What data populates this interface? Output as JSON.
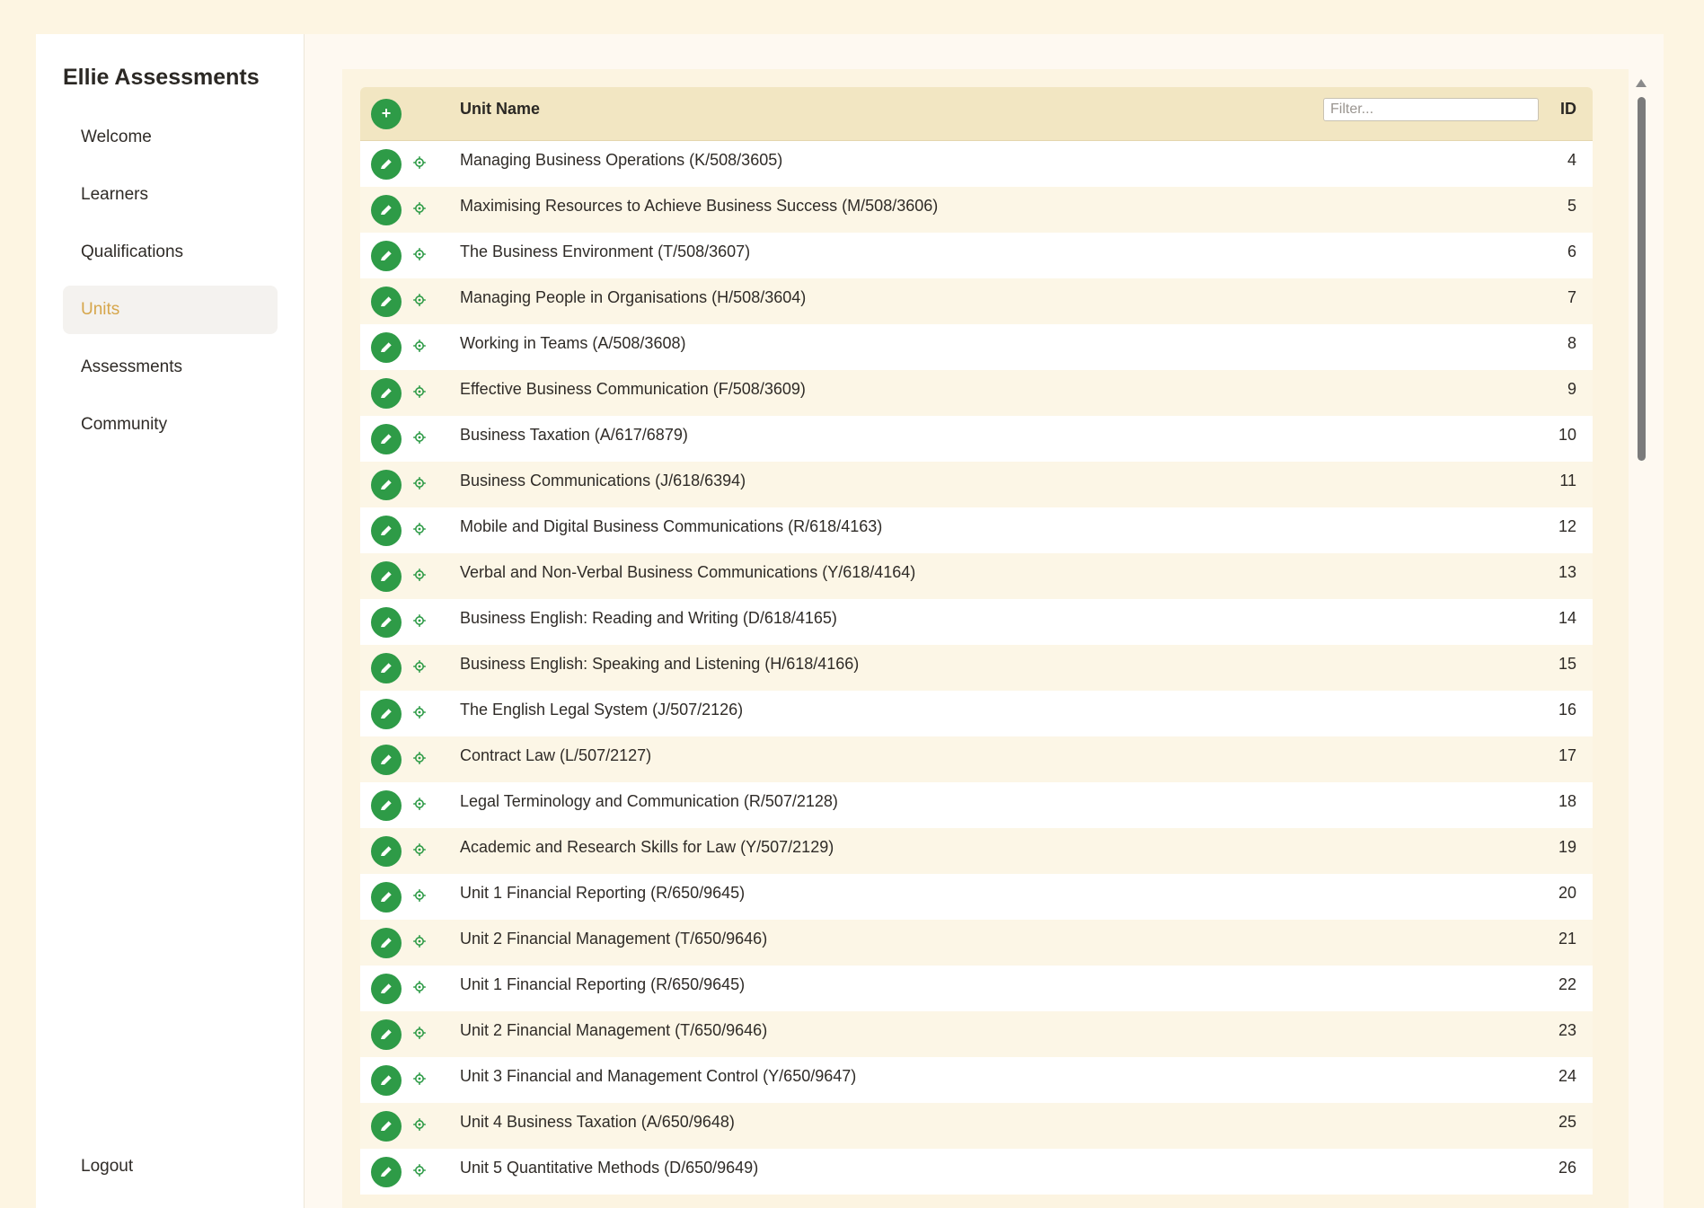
{
  "app": {
    "title": "Ellie Assessments"
  },
  "nav": {
    "items": [
      {
        "label": "Welcome"
      },
      {
        "label": "Learners"
      },
      {
        "label": "Qualifications"
      },
      {
        "label": "Units"
      },
      {
        "label": "Assessments"
      },
      {
        "label": "Community"
      }
    ],
    "active": "Units",
    "logout_label": "Logout"
  },
  "table": {
    "add_label": "+",
    "col_name": "Unit Name",
    "col_id": "ID",
    "filter_placeholder": "Filter...",
    "rows": [
      {
        "name": "Managing Business Operations (K/508/3605)",
        "id": "4"
      },
      {
        "name": "Maximising Resources to Achieve Business Success (M/508/3606)",
        "id": "5"
      },
      {
        "name": "The Business Environment (T/508/3607)",
        "id": "6"
      },
      {
        "name": "Managing People in Organisations (H/508/3604)",
        "id": "7"
      },
      {
        "name": "Working in Teams (A/508/3608)",
        "id": "8"
      },
      {
        "name": "Effective Business Communication (F/508/3609)",
        "id": "9"
      },
      {
        "name": "Business Taxation (A/617/6879)",
        "id": "10"
      },
      {
        "name": "Business Communications (J/618/6394)",
        "id": "11"
      },
      {
        "name": "Mobile and Digital Business Communications (R/618/4163)",
        "id": "12"
      },
      {
        "name": "Verbal and Non-Verbal Business Communications (Y/618/4164)",
        "id": "13"
      },
      {
        "name": "Business English: Reading and Writing (D/618/4165)",
        "id": "14"
      },
      {
        "name": "Business English: Speaking and Listening (H/618/4166)",
        "id": "15"
      },
      {
        "name": "The English Legal System (J/507/2126)",
        "id": "16"
      },
      {
        "name": "Contract Law (L/507/2127)",
        "id": "17"
      },
      {
        "name": "Legal Terminology and Communication (R/507/2128)",
        "id": "18"
      },
      {
        "name": "Academic and Research Skills for Law (Y/507/2129)",
        "id": "19"
      },
      {
        "name": "Unit 1 Financial Reporting (R/650/9645)",
        "id": "20"
      },
      {
        "name": "Unit 2 Financial Management (T/650/9646)",
        "id": "21"
      },
      {
        "name": "Unit 1 Financial Reporting (R/650/9645)",
        "id": "22"
      },
      {
        "name": "Unit 2 Financial Management (T/650/9646)",
        "id": "23"
      },
      {
        "name": "Unit 3 Financial and Management Control (Y/650/9647)",
        "id": "24"
      },
      {
        "name": "Unit 4 Business Taxation (A/650/9648)",
        "id": "25"
      },
      {
        "name": "Unit 5 Quantitative Methods (D/650/9649)",
        "id": "26"
      }
    ]
  },
  "icons": {
    "add": "plus-icon",
    "edit": "pencil-icon",
    "settings": "gear-icon",
    "scroll_up": "chevron-up-icon"
  },
  "colors": {
    "accent_green": "#2e9b47",
    "active_nav_text": "#d6a64b",
    "header_bg": "#f2e6c2",
    "page_bg": "#fdf5e2"
  }
}
